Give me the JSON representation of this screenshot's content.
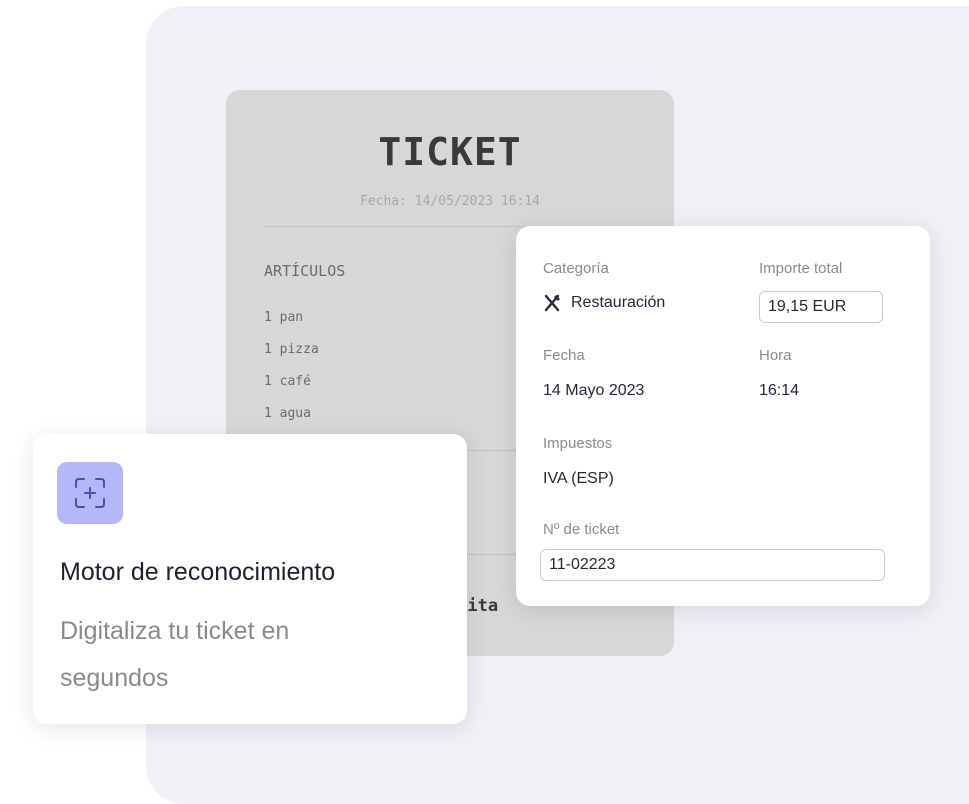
{
  "receipt": {
    "title": "TICKET",
    "date": "Fecha: 14/05/2023 16:14",
    "section": "ARTÍCULOS",
    "items": [
      "1 pan",
      "1 pizza",
      "1 café",
      "1 agua"
    ],
    "footer": "su visita"
  },
  "extracted": {
    "category_label": "Categoría",
    "category_value": "Restauración",
    "category_icon": "cutlery-icon",
    "total_label": "Importe total",
    "total_value": "19,15 EUR",
    "date_label": "Fecha",
    "date_value": "14 Mayo 2023",
    "time_label": "Hora",
    "time_value": "16:14",
    "tax_label": "Impuestos",
    "tax_value": "IVA (ESP)",
    "ticket_no_label": "Nº de ticket",
    "ticket_no_value": "11-02223"
  },
  "feature": {
    "icon": "scan-plus-icon",
    "title": "Motor de reconocimiento",
    "description": "Digitaliza tu ticket en segundos"
  },
  "colors": {
    "accent": "#b4b8f8",
    "receipt_bg": "#d7d7d7",
    "backdrop": "#f0f0f6"
  }
}
